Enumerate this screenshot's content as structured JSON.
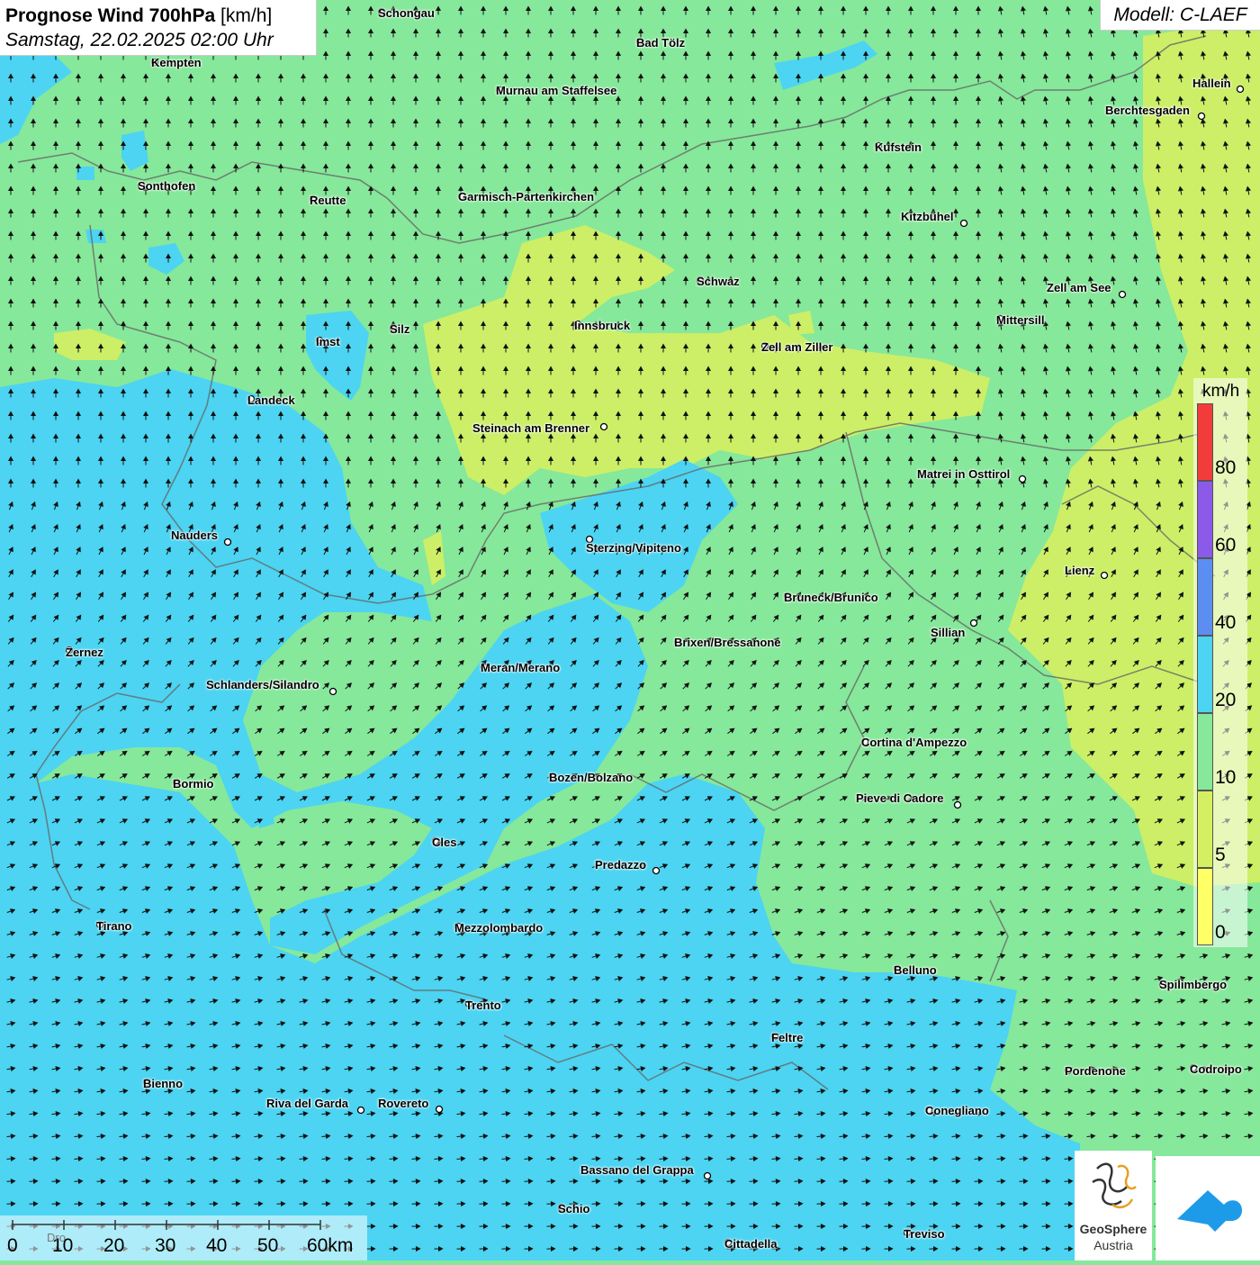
{
  "title": {
    "main": "Prognose Wind 700hPa",
    "unit": "[km/h]",
    "datetime": "Samstag, 22.02.2025 02:00 Uhr"
  },
  "model": "Modell: C-LAEF",
  "colors": {
    "wind_0_5": "#ffff66",
    "wind_5_10": "#d4f062",
    "wind_10_20": "#86e89a",
    "wind_20_40": "#4cd4f2",
    "wind_40_60": "#5b8ef0",
    "wind_60_80": "#8c5ae8",
    "wind_80_plus": "#f23c3c",
    "borders": "#666666"
  },
  "legend": {
    "unit": "km/h",
    "labels": [
      "80",
      "60",
      "40",
      "20",
      "10",
      "5",
      "0"
    ],
    "swatches": [
      "#f23c3c",
      "#8c5ae8",
      "#5b8ef0",
      "#4cd4f2",
      "#86e89a",
      "#d4f062",
      "#ffff66"
    ]
  },
  "scale": {
    "labels": [
      "0",
      "10",
      "20",
      "30",
      "40",
      "50",
      "60km"
    ],
    "faint_label": "Dro"
  },
  "cities": [
    "Schongau",
    "Bad Tölz",
    "Kempten",
    "Murnau am Staffelsee",
    "Hallein",
    "Berchtesgaden",
    "Kufstein",
    "Sonthofen",
    "Reutte",
    "Garmisch-Partenkirchen",
    "Kitzbühel",
    "Schwaz",
    "Zell am See",
    "Mittersill",
    "Innsbruck",
    "Silz",
    "Imst",
    "Zell am Ziller",
    "Landeck",
    "Steinach am Brenner",
    "Matrei in Osttirol",
    "Nauders",
    "Sterzing/Vipiteno",
    "Lienz",
    "Bruneck/Brunico",
    "Sillian",
    "Brixen/Bressanone",
    "Zernez",
    "Meran/Merano",
    "Schlanders/Silandro",
    "Cortina d'Ampezzo",
    "Bozen/Bolzano",
    "Bormio",
    "Pieve di Cadore",
    "Cles",
    "Predazzo",
    "Tirano",
    "Mezzolombardo",
    "Belluno",
    "Spilimbergo",
    "Trento",
    "Feltre",
    "Pordenone",
    "Codroipo",
    "Bienno",
    "Riva del Garda",
    "Rovereto",
    "Conegliano",
    "Bassano del Grappa",
    "Schio",
    "Treviso",
    "Cittadella"
  ],
  "logos": {
    "geosphere_name": "GeoSphere",
    "geosphere_sub": "Austria",
    "app_icon": "cloud-app-icon"
  }
}
